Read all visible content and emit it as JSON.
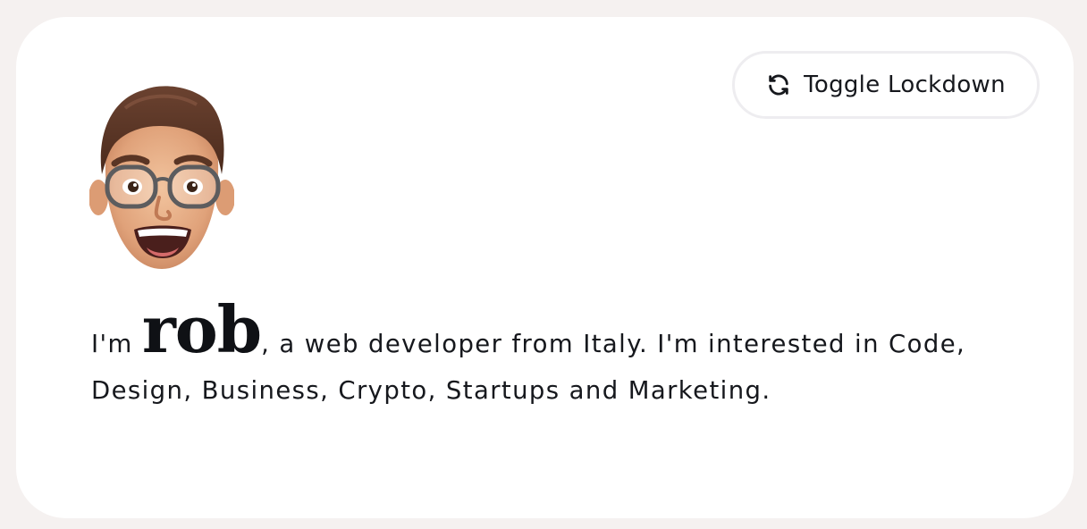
{
  "toggle": {
    "label": "Toggle Lockdown",
    "icon": "refresh-icon"
  },
  "avatar": {
    "icon": "memoji-avatar"
  },
  "intro": {
    "prefix": "I'm ",
    "name": "rob",
    "rest": ", a web developer from Italy. I'm interested in Code, Design, Business, Crypto, Startups and Marketing."
  },
  "colors": {
    "page_background": "#f5f1f0",
    "card_background": "#ffffff",
    "text": "#16181d",
    "button_border": "#eeedf0"
  }
}
